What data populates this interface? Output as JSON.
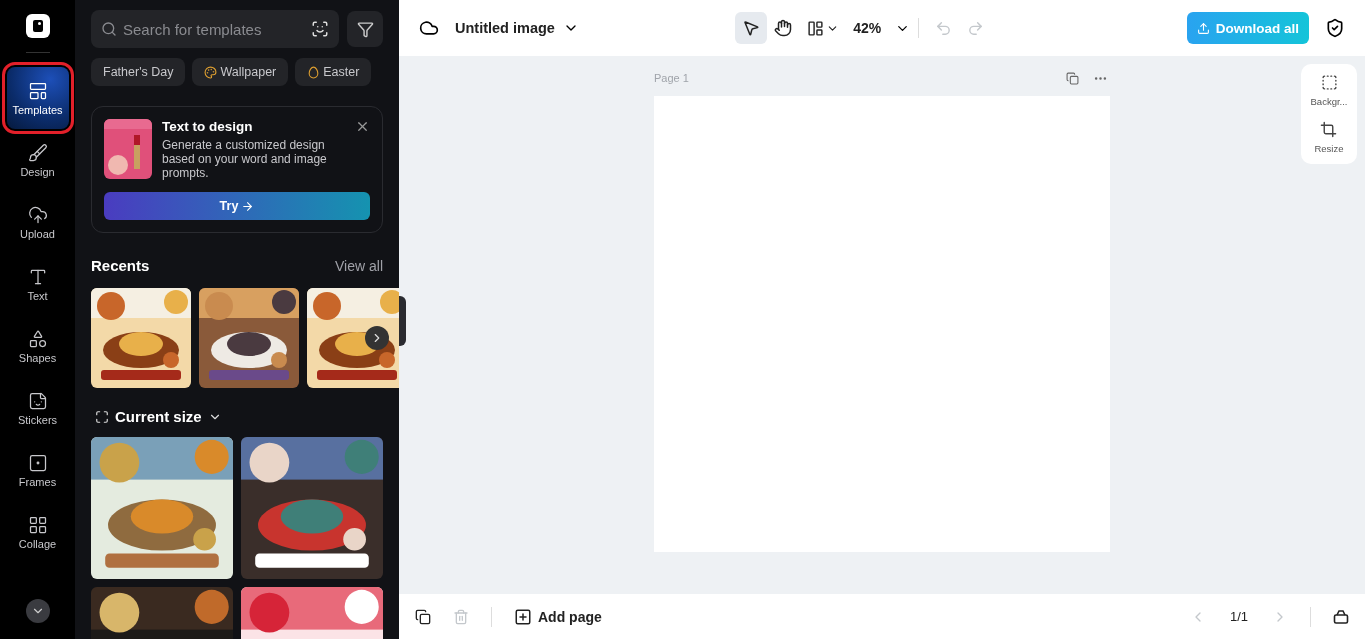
{
  "rail": {
    "items": [
      {
        "kind": "templates",
        "label": "Templates",
        "selected": true
      },
      {
        "kind": "design",
        "label": "Design",
        "selected": false
      },
      {
        "kind": "upload",
        "label": "Upload",
        "selected": false
      },
      {
        "kind": "text",
        "label": "Text",
        "selected": false
      },
      {
        "kind": "shapes",
        "label": "Shapes",
        "selected": false
      },
      {
        "kind": "stickers",
        "label": "Stickers",
        "selected": false
      },
      {
        "kind": "frames",
        "label": "Frames",
        "selected": false
      },
      {
        "kind": "collage",
        "label": "Collage",
        "selected": false
      }
    ]
  },
  "panel": {
    "search": {
      "placeholder": "Search for templates"
    },
    "chips": [
      {
        "kind": "plain",
        "label": "Father's Day"
      },
      {
        "kind": "palette",
        "label": "Wallpaper"
      },
      {
        "kind": "egg",
        "label": "Easter"
      }
    ],
    "promo": {
      "title": "Text to design",
      "body": "Generate a customized design based on your word and image prompts.",
      "button": "Try"
    },
    "recents": {
      "title": "Recents",
      "link": "View all"
    },
    "current_size": {
      "title": "Current size"
    }
  },
  "toolbar": {
    "title": "Untitled image",
    "zoom": "42%",
    "download": "Download all"
  },
  "canvas": {
    "page_label": "Page 1"
  },
  "side_tools": [
    {
      "kind": "background",
      "label": "Backgr..."
    },
    {
      "kind": "resize",
      "label": "Resize"
    }
  ],
  "bottom_bar": {
    "add_page": "Add page",
    "pages": "1/1"
  }
}
